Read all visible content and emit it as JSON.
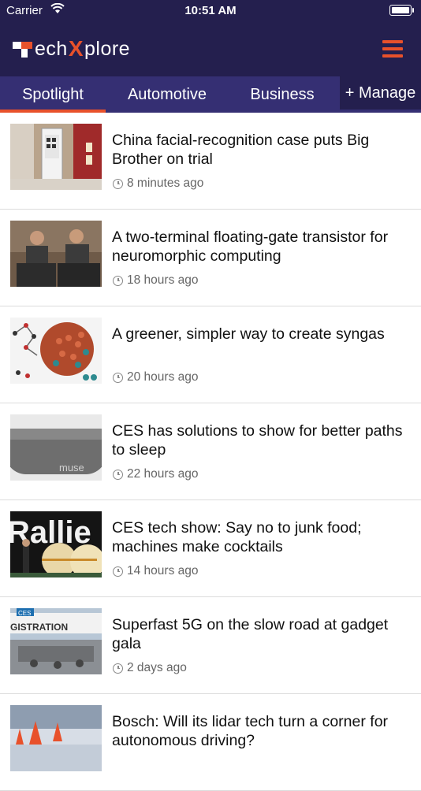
{
  "status_bar": {
    "carrier": "Carrier",
    "time": "10:51 AM"
  },
  "header": {
    "logo_t": "ech",
    "logo_x": "X",
    "logo_rest": "plore"
  },
  "tabs": [
    {
      "label": "Spotlight",
      "active": true
    },
    {
      "label": "Automotive",
      "active": false
    },
    {
      "label": "Business",
      "active": false
    }
  ],
  "manage_label": "+ Manage",
  "articles": [
    {
      "title": "China facial-recognition case puts Big Brother on trial",
      "time": "8 minutes ago"
    },
    {
      "title": "A two-terminal floating-gate transistor for neuromorphic computing",
      "time": "18 hours ago"
    },
    {
      "title": "A greener, simpler way to create syngas",
      "time": "20 hours ago"
    },
    {
      "title": "CES has solutions to show for better paths to sleep",
      "time": "22 hours ago"
    },
    {
      "title": "CES tech show: Say no to junk food; machines make cocktails",
      "time": "14 hours ago"
    },
    {
      "title": "Superfast 5G on the slow road at gadget gala",
      "time": "2 days ago"
    },
    {
      "title": "Bosch: Will its lidar tech turn a corner for autonomous driving?",
      "time": ""
    }
  ],
  "thumb_text": {
    "muse": "muse",
    "ces_banner": "CES",
    "registration": "GISTRATION",
    "rallie": "Rallie"
  },
  "colors": {
    "header_bg": "#241f4e",
    "tab_bg": "#352f73",
    "accent": "#e8512b"
  }
}
